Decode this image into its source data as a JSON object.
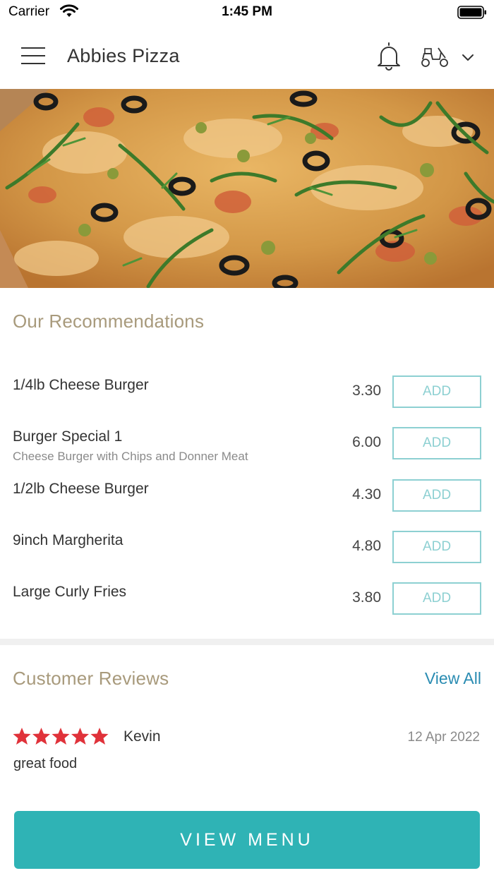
{
  "status_bar": {
    "carrier": "Carrier",
    "time": "1:45 PM"
  },
  "header": {
    "title": "Abbies Pizza",
    "menu_icon": "hamburger-menu-icon",
    "notification_icon": "bell-icon",
    "delivery_icon": "scooter-icon",
    "dropdown_icon": "chevron-down-icon"
  },
  "hero": {
    "image": "pizza-banner"
  },
  "recommendations": {
    "title": "Our Recommendations",
    "add_label": "ADD",
    "items": [
      {
        "name": "1/4lb Cheese Burger",
        "description": "",
        "price": "3.30"
      },
      {
        "name": "Burger Special 1",
        "description": "Cheese Burger with Chips and Donner Meat",
        "price": "6.00"
      },
      {
        "name": "1/2lb Cheese Burger",
        "description": "",
        "price": "4.30"
      },
      {
        "name": "9inch Margherita",
        "description": "",
        "price": "4.80"
      },
      {
        "name": "Large Curly Fries",
        "description": "",
        "price": "3.80"
      }
    ]
  },
  "reviews": {
    "title": "Customer Reviews",
    "view_all_label": "View All",
    "items": [
      {
        "author": "Kevin",
        "rating": 5,
        "date": "12 Apr 2022",
        "text": "great food"
      }
    ]
  },
  "footer": {
    "view_menu_label": "VIEW MENU"
  },
  "colors": {
    "accent_teal": "#2fb3b5",
    "add_border": "#8dd0d2",
    "section_title": "#a89a7c",
    "link_blue": "#2a8cb2",
    "star_red": "#e0323a"
  }
}
